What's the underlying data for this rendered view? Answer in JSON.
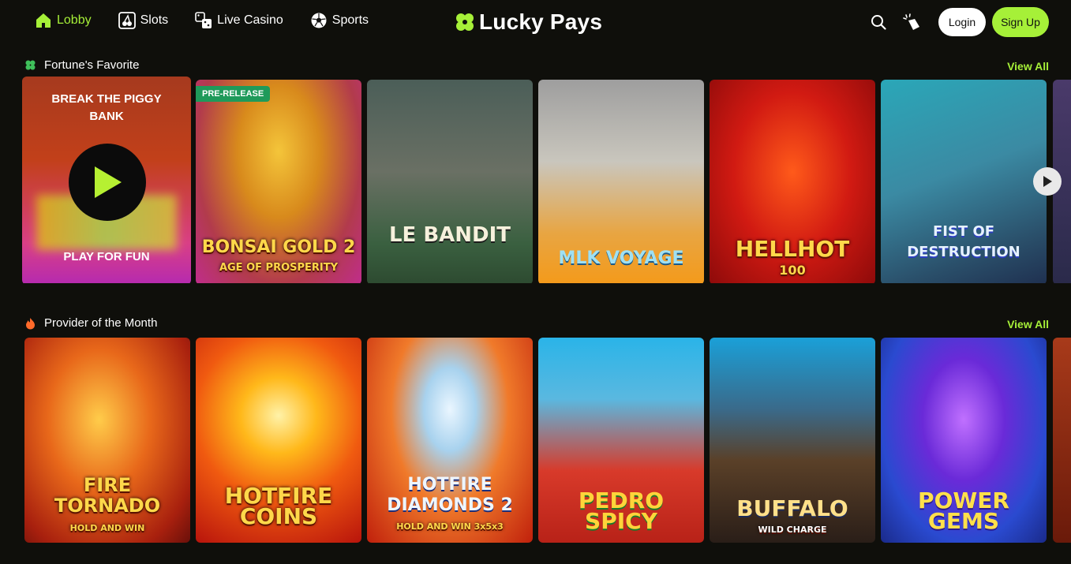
{
  "nav": {
    "lobby": "Lobby",
    "slots": "Slots",
    "live_casino": "Live Casino",
    "sports": "Sports"
  },
  "brand": {
    "name": "Lucky Pays",
    "accent": "#a6f038"
  },
  "auth": {
    "login": "Login",
    "signup": "Sign Up"
  },
  "sections": [
    {
      "title": "Fortune's Favorite",
      "icon": "clover-icon",
      "view_all": "View All",
      "featured": {
        "title": "BREAK THE PIGGY BANK",
        "action": "PLAY FOR FUN"
      },
      "games": [
        {
          "name": "BONSAI GOLD 2",
          "subtitle": "AGE OF PROSPERITY",
          "badge": "PRE-RELEASE"
        },
        {
          "name": "LE BANDIT"
        },
        {
          "name": "MLK VOYAGE"
        },
        {
          "name": "HELLHOT",
          "subtitle": "100"
        },
        {
          "name": "FIST OF DESTRUCTION"
        }
      ]
    },
    {
      "title": "Provider of the Month",
      "icon": "flame-icon",
      "view_all": "View All",
      "games": [
        {
          "name": "FIRE TORNADO",
          "subtitle": "HOLD AND WIN"
        },
        {
          "name": "HOTFIRE COINS"
        },
        {
          "name": "HOTFIRE DIAMONDS 2",
          "subtitle": "HOLD AND WIN 3x5x3"
        },
        {
          "name": "PEDRO SPICY"
        },
        {
          "name": "BUFFALO",
          "subtitle": "WILD CHARGE"
        },
        {
          "name": "POWER GEMS"
        }
      ]
    }
  ]
}
